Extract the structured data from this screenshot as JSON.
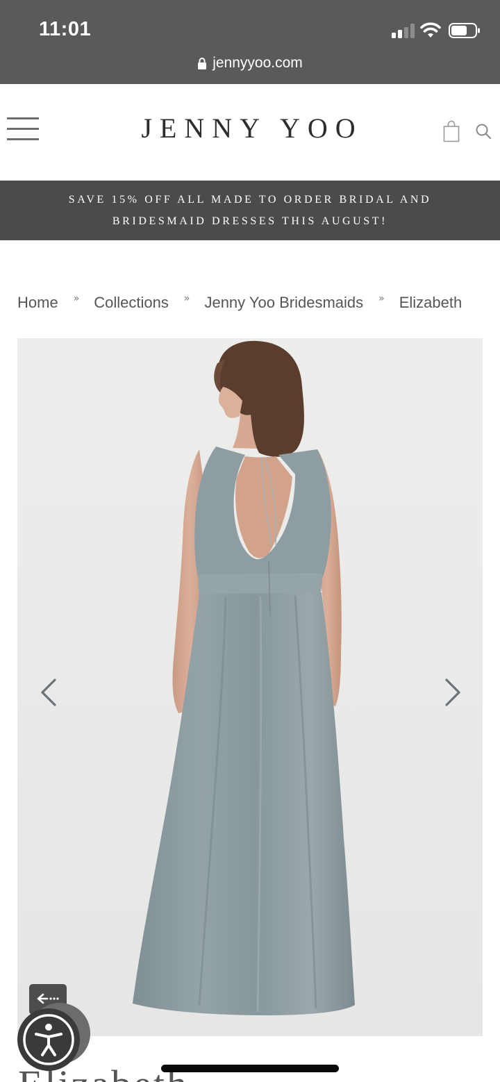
{
  "status_bar": {
    "time": "11:01"
  },
  "browser": {
    "url": "jennyyoo.com",
    "icons": [
      "lock-icon",
      "cellular-signal-icon",
      "wifi-icon",
      "battery-icon"
    ]
  },
  "header": {
    "logo": "JENNY YOO",
    "icons": [
      "hamburger-menu-icon",
      "shopping-bag-icon",
      "search-icon"
    ]
  },
  "promo": {
    "line1": "SAVE 15% OFF ALL MADE TO ORDER BRIDAL AND",
    "line2": "BRIDESMAID DRESSES THIS AUGUST!"
  },
  "breadcrumb": {
    "separator": "»",
    "items": [
      {
        "label": "Home"
      },
      {
        "label": "Collections"
      },
      {
        "label": "Jenny Yoo Bridesmaids"
      },
      {
        "label": "Elizabeth"
      }
    ]
  },
  "gallery": {
    "image_alt": "Model wearing dusty blue chiffon gown with open keyhole back",
    "icons": [
      "chevron-left-icon",
      "chevron-right-icon"
    ],
    "colors": {
      "background": "#ebebeb",
      "dress": "#8b9a9f",
      "hair": "#5b3d2e"
    }
  },
  "product": {
    "title": "Elizabeth"
  },
  "accessibility": {
    "icons": [
      "back-arrow-icon",
      "accessibility-icon"
    ]
  }
}
